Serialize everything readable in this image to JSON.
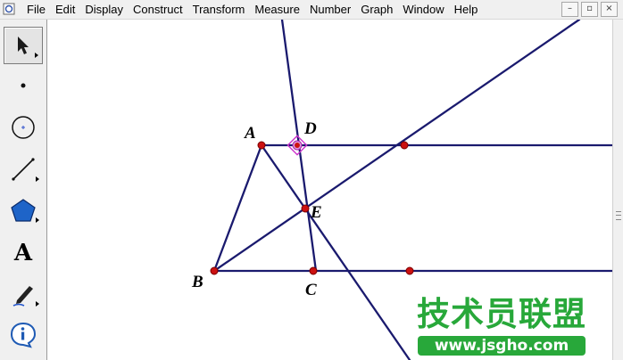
{
  "menubar": {
    "items": [
      {
        "label": "File"
      },
      {
        "label": "Edit"
      },
      {
        "label": "Display"
      },
      {
        "label": "Construct"
      },
      {
        "label": "Transform"
      },
      {
        "label": "Measure"
      },
      {
        "label": "Number"
      },
      {
        "label": "Graph"
      },
      {
        "label": "Window"
      },
      {
        "label": "Help"
      }
    ],
    "window_controls": {
      "minimize": "–",
      "restore": "▫",
      "close": "×"
    }
  },
  "toolbox": {
    "tools": [
      "arrow-tool",
      "point-tool",
      "compass-tool",
      "straightedge-tool",
      "polygon-tool",
      "text-tool",
      "marker-tool",
      "information-tool"
    ],
    "text_tool_glyph": "A",
    "info_tool_glyph": "i"
  },
  "canvas": {
    "line_color": "#1a1a6e",
    "point_color": "#cc1111",
    "selected_point_color": "#cc33cc",
    "points": {
      "A": {
        "label": "A"
      },
      "B": {
        "label": "B"
      },
      "C": {
        "label": "C"
      },
      "D": {
        "label": "D"
      },
      "E": {
        "label": "E"
      }
    }
  },
  "watermark": {
    "title": "技术员联盟",
    "url": "www.jsgho.com",
    "color": "#28a83a"
  }
}
